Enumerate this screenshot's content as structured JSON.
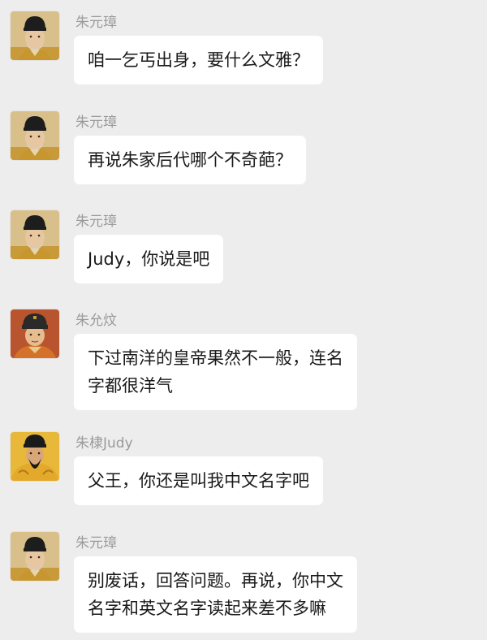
{
  "messages": [
    {
      "sender": "朱元璋",
      "avatar_icon": "zhu-yuanzhang-portrait-icon",
      "lines": [
        "咱一乞丐出身，要什么文雅？"
      ]
    },
    {
      "sender": "朱元璋",
      "avatar_icon": "zhu-yuanzhang-portrait-icon",
      "lines": [
        "再说朱家后代哪个不奇葩？"
      ]
    },
    {
      "sender": "朱元璋",
      "avatar_icon": "zhu-yuanzhang-portrait-icon",
      "lines": [
        "Judy，你说是吧"
      ]
    },
    {
      "sender": "朱允炆",
      "avatar_icon": "zhu-yunwen-portrait-icon",
      "lines": [
        "下过南洋的皇帝果然不一般，连名",
        "字都很洋气"
      ]
    },
    {
      "sender": "朱棣Judy",
      "avatar_icon": "zhu-di-portrait-icon",
      "lines": [
        "父王，你还是叫我中文名字吧"
      ]
    },
    {
      "sender": "朱元璋",
      "avatar_icon": "zhu-yuanzhang-portrait-icon",
      "lines": [
        "别废话，回答问题。再说，你中文",
        "名字和英文名字读起来差不多嘛"
      ]
    }
  ],
  "colors": {
    "background": "#ededed",
    "bubble": "#ffffff",
    "sender_text": "#9a9a9a",
    "message_text": "#191919"
  }
}
